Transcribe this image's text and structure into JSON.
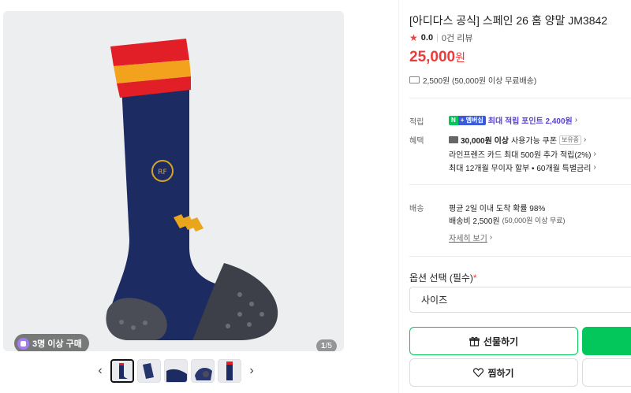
{
  "gallery": {
    "badge_text": "3명 이상 구매",
    "counter_current": "1",
    "counter_total": "/5",
    "prev_label": "‹",
    "next_label": "›"
  },
  "product": {
    "title": "[아디다스 공식] 스페인 26 홈 양말 JM3842",
    "rating_star": "★",
    "rating_score": "0.0",
    "rating_sep": "|",
    "review_count": "0건 리뷰",
    "price_value": "25,000",
    "price_unit": "원",
    "shipping_short": "2,500원 (50,000원 이상 무료배송)"
  },
  "benefits": {
    "points_label": "적립",
    "npay_n": "N",
    "npay_m": "+ 멤버십",
    "points_text": "최대 적립 포인트 2,400원",
    "points_chev": "›",
    "benefit_label": "혜택",
    "coupon_strong": "30,000원 이상",
    "coupon_text": "사용가능 쿠폰",
    "coupon_tag": "보유중",
    "coupon_chev": "›",
    "card_text": "라인프렌즈 카드 최대 500원 추가 적립(2%)",
    "card_chev": "›",
    "installment_text": "최대 12개월 무이자 할부 • 60개월 특별금리",
    "installment_chev": "›"
  },
  "delivery": {
    "label": "배송",
    "arrival": "평균 2일 이내 도착 확률 98%",
    "fee_main": "배송비 2,500원",
    "fee_sub": "(50,000원 이상 무료)",
    "detail_link": "자세히 보기",
    "detail_chev": "›"
  },
  "options": {
    "label": "옵션 선택 (필수)",
    "required_mark": "*",
    "size_placeholder": "사이즈"
  },
  "buttons": {
    "gift": "선물하기",
    "wish": "찜하기"
  },
  "colors": {
    "accent_green": "#03c75a",
    "price_red": "#f03a3a",
    "point_purple": "#5a3ee0"
  }
}
